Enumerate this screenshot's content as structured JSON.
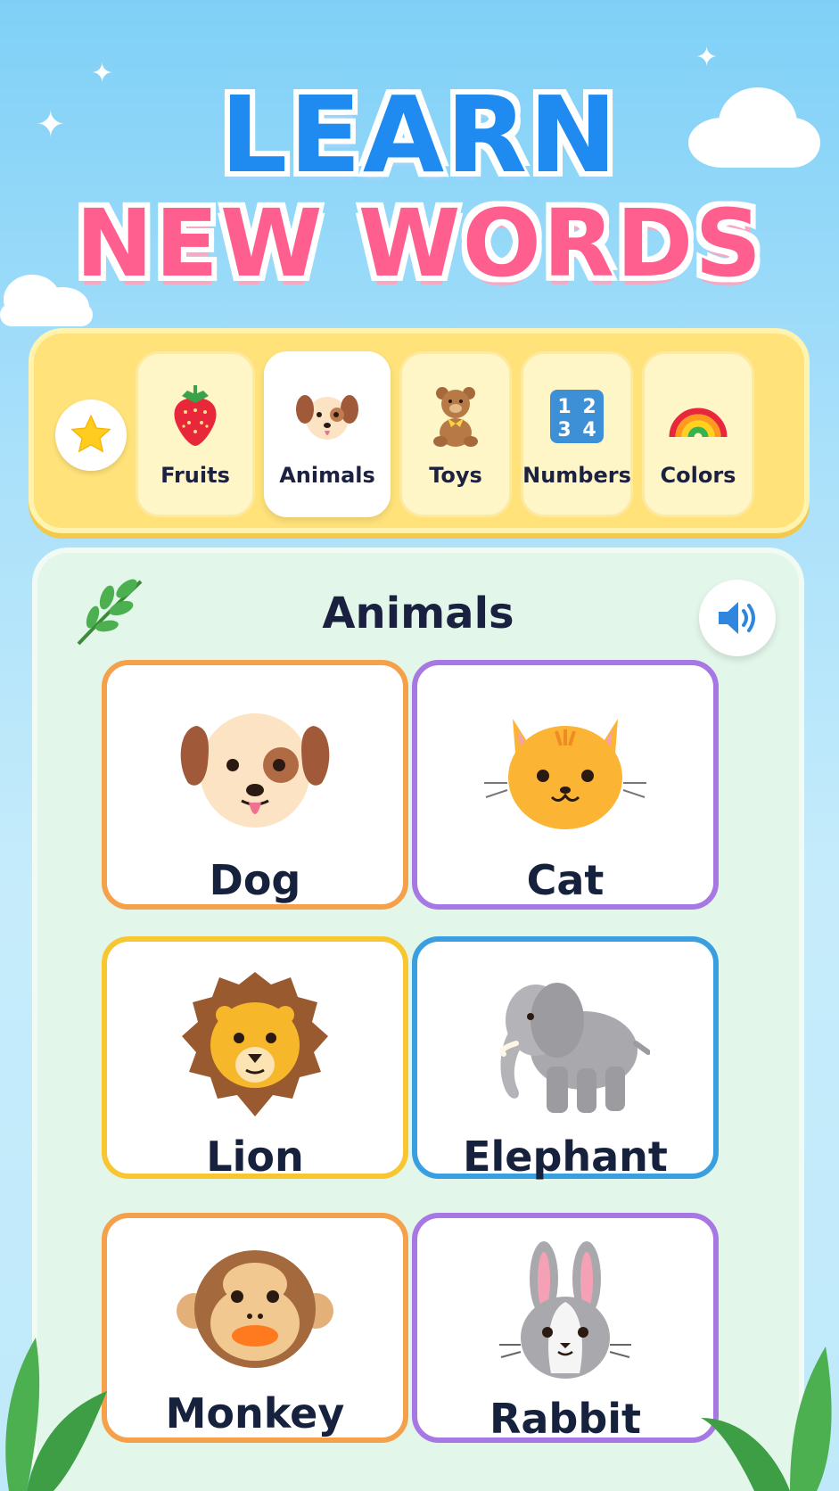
{
  "header": {
    "title_line1": "LEARN",
    "title_line2": "NEW WORDS"
  },
  "categories": {
    "favorites_icon": "star-icon",
    "tabs": [
      {
        "label": "Fruits",
        "icon": "strawberry-icon",
        "active": false
      },
      {
        "label": "Animals",
        "icon": "dog-face-icon",
        "active": true
      },
      {
        "label": "Toys",
        "icon": "teddy-bear-icon",
        "active": false
      },
      {
        "label": "Numbers",
        "icon": "numbers-icon",
        "active": false
      },
      {
        "label": "Colors",
        "icon": "rainbow-icon",
        "active": false
      }
    ]
  },
  "panel": {
    "title": "Animals",
    "decor_icon": "leaf-icon",
    "sound_icon": "speaker-icon",
    "cards": [
      {
        "label": "Dog",
        "icon": "dog-icon",
        "border_color": "#f5a04a"
      },
      {
        "label": "Cat",
        "icon": "cat-icon",
        "border_color": "#a778e4"
      },
      {
        "label": "Lion",
        "icon": "lion-icon",
        "border_color": "#f7c630"
      },
      {
        "label": "Elephant",
        "icon": "elephant-icon",
        "border_color": "#3a9fe0"
      },
      {
        "label": "Monkey",
        "icon": "monkey-icon",
        "border_color": "#f5a04a"
      },
      {
        "label": "Rabbit",
        "icon": "rabbit-icon",
        "border_color": "#a778e4"
      }
    ]
  },
  "colors": {
    "title_blue": "#1f8bf0",
    "title_pink": "#ff5f8f",
    "category_bar": "#ffe27a",
    "panel_bg": "#e3f6ea"
  }
}
